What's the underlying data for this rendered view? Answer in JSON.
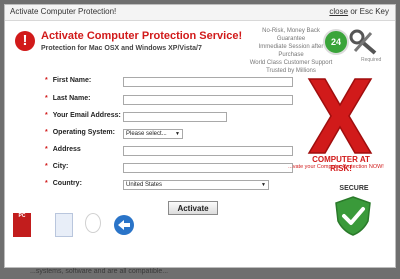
{
  "window": {
    "title": "Activate Computer Protection!",
    "close_link": "close",
    "close_suffix": " or Esc Key"
  },
  "header": {
    "title": "Activate Computer Protection Service!",
    "subtitle": "Protection for Mac OSX and Windows XP/Vista/7",
    "guarantee_lines": [
      "No-Risk, Money Back Guarantee",
      "Immediate Session after Purchase",
      "World Class Customer Support",
      "Trusted by Millions"
    ],
    "badge_24": "24",
    "required_note": "Required"
  },
  "form": {
    "first_name": {
      "label": "First Name:",
      "value": ""
    },
    "last_name": {
      "label": "Last Name:",
      "value": ""
    },
    "email": {
      "label": "Your Email Address:",
      "value": ""
    },
    "os": {
      "label": "Operating System:",
      "selected": "Please select..."
    },
    "address": {
      "label": "Address",
      "value": ""
    },
    "city": {
      "label": "City:",
      "value": ""
    },
    "country": {
      "label": "Country:",
      "selected": "United States"
    },
    "submit_label": "Activate"
  },
  "risk": {
    "headline": "COMPUTER AT RISK!",
    "subline": "...vate your Computer Protection NOW!"
  },
  "secure": {
    "label": "SECURE"
  },
  "logos": [
    "pc-magazine-logo",
    "editors-choice-logo",
    "award-badge-logo",
    "teamviewer-logo"
  ],
  "background_text": "...systems, software and are all compatible..."
}
